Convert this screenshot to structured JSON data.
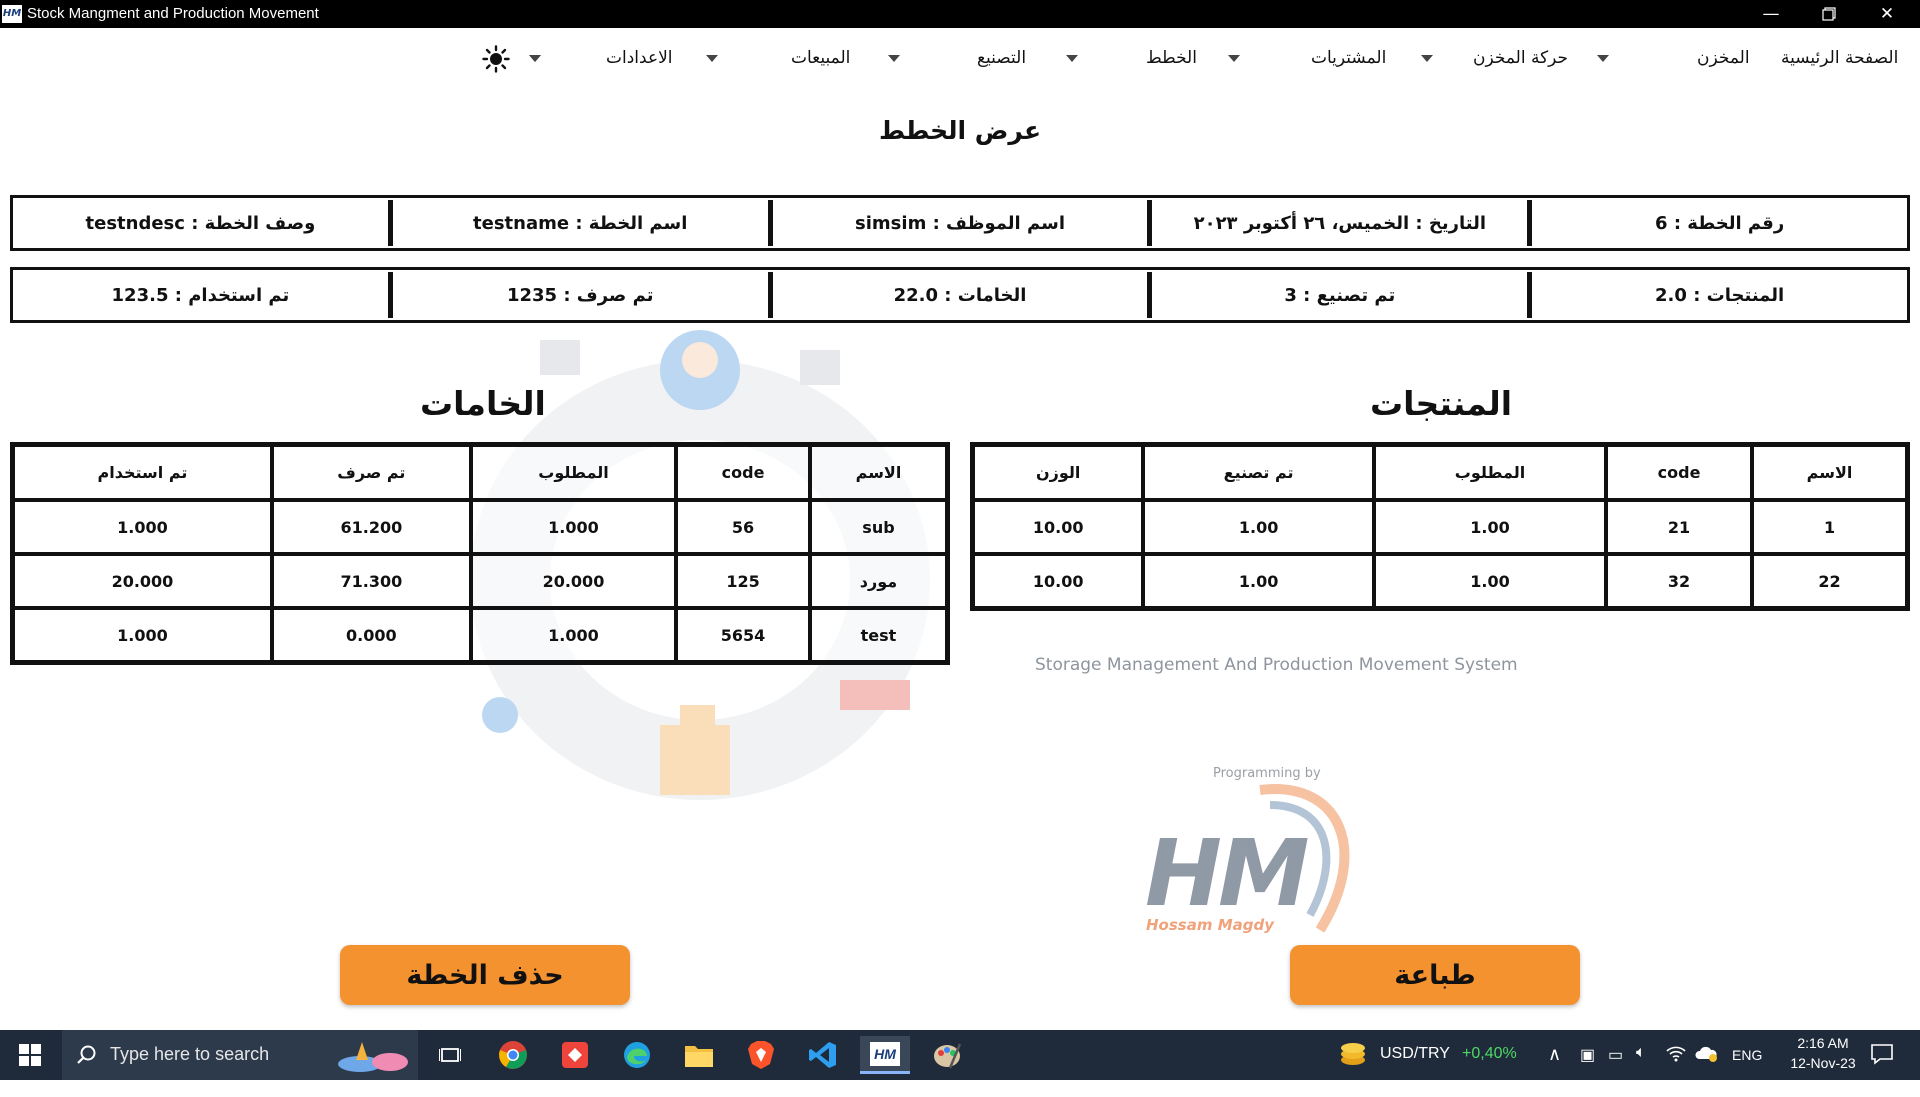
{
  "window": {
    "title": "Stock Mangment and Production Movement",
    "app_icon": "HM",
    "controls": [
      "minimize-icon",
      "restore-icon",
      "close-icon"
    ]
  },
  "menu": {
    "items": [
      {
        "label": "الصفحة الرئيسية",
        "dropdown": false
      },
      {
        "label": "المخزن",
        "dropdown": true
      },
      {
        "label": "حركة المخزن",
        "dropdown": true
      },
      {
        "label": "المشتريات",
        "dropdown": true
      },
      {
        "label": "الخطط",
        "dropdown": true
      },
      {
        "label": "التصنيع",
        "dropdown": true
      },
      {
        "label": "المبيعات",
        "dropdown": true
      },
      {
        "label": "الاعدادات",
        "dropdown": true
      }
    ],
    "theme_icon": "sun-icon"
  },
  "page_title": "عرض الخطط",
  "plan_info": {
    "row1": [
      "رقم الخطة : 6",
      "التاريخ : الخميس، ٢٦ أكتوبر ٢٠٢٣",
      "اسم الموظف : simsim",
      "اسم الخطة : testname",
      "وصف الخطة : testndesc"
    ],
    "row2": [
      "المنتجات : 2.0",
      "تم تصنيع : 3",
      "الخامات : 22.0",
      "تم صرف : 1235",
      "تم استخدام : 123.5"
    ]
  },
  "products": {
    "title": "المنتجات",
    "headers": [
      "الاسم",
      "code",
      "المطلوب",
      "تم تصنيع",
      "الوزن"
    ],
    "rows": [
      [
        "1",
        "21",
        "1.00",
        "1.00",
        "10.00"
      ],
      [
        "22",
        "32",
        "1.00",
        "1.00",
        "10.00"
      ]
    ]
  },
  "materials": {
    "title": "الخامات",
    "headers": [
      "الاسم",
      "code",
      "المطلوب",
      "تم صرف",
      "تم استخدام"
    ],
    "rows": [
      [
        "sub",
        "56",
        "1.000",
        "61.200",
        "1.000"
      ],
      [
        "مورد",
        "125",
        "20.000",
        "71.300",
        "20.000"
      ],
      [
        "test",
        "5654",
        "1.000",
        "0.000",
        "1.000"
      ]
    ]
  },
  "watermark": {
    "subtitle": "Storage Management And Production Movement System",
    "programming_by": "Programming by",
    "logo": "HM",
    "author": "Hossam Magdy"
  },
  "buttons": {
    "print": "طباعة",
    "delete_plan": "حذف الخطة"
  },
  "taskbar": {
    "search_placeholder": "Type here to search",
    "currency_pair": "USD/TRY",
    "currency_change": "+0,40%",
    "language": "ENG",
    "time": "2:16 AM",
    "date": "12-Nov-23"
  },
  "colors": {
    "accent_button": "#f3922f",
    "titlebar": "#000000",
    "taskbar": "#1f2b3a",
    "currency_positive": "#4cd964"
  }
}
